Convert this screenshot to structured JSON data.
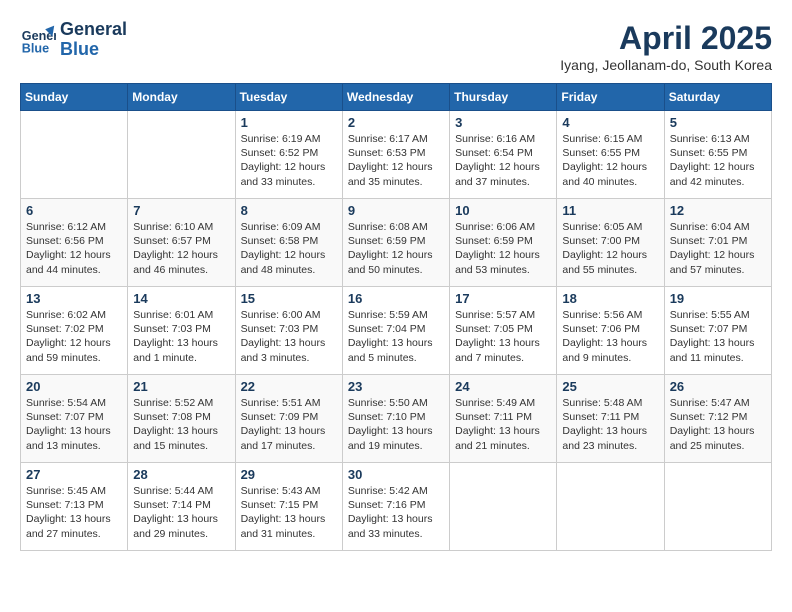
{
  "header": {
    "logo_line1": "General",
    "logo_line2": "Blue",
    "month": "April 2025",
    "location": "Iyang, Jeollanam-do, South Korea"
  },
  "days_of_week": [
    "Sunday",
    "Monday",
    "Tuesday",
    "Wednesday",
    "Thursday",
    "Friday",
    "Saturday"
  ],
  "weeks": [
    [
      {
        "day": "",
        "empty": true
      },
      {
        "day": "",
        "empty": true
      },
      {
        "day": "1",
        "sunrise": "6:19 AM",
        "sunset": "6:52 PM",
        "daylight": "12 hours and 33 minutes."
      },
      {
        "day": "2",
        "sunrise": "6:17 AM",
        "sunset": "6:53 PM",
        "daylight": "12 hours and 35 minutes."
      },
      {
        "day": "3",
        "sunrise": "6:16 AM",
        "sunset": "6:54 PM",
        "daylight": "12 hours and 37 minutes."
      },
      {
        "day": "4",
        "sunrise": "6:15 AM",
        "sunset": "6:55 PM",
        "daylight": "12 hours and 40 minutes."
      },
      {
        "day": "5",
        "sunrise": "6:13 AM",
        "sunset": "6:55 PM",
        "daylight": "12 hours and 42 minutes."
      }
    ],
    [
      {
        "day": "6",
        "sunrise": "6:12 AM",
        "sunset": "6:56 PM",
        "daylight": "12 hours and 44 minutes."
      },
      {
        "day": "7",
        "sunrise": "6:10 AM",
        "sunset": "6:57 PM",
        "daylight": "12 hours and 46 minutes."
      },
      {
        "day": "8",
        "sunrise": "6:09 AM",
        "sunset": "6:58 PM",
        "daylight": "12 hours and 48 minutes."
      },
      {
        "day": "9",
        "sunrise": "6:08 AM",
        "sunset": "6:59 PM",
        "daylight": "12 hours and 50 minutes."
      },
      {
        "day": "10",
        "sunrise": "6:06 AM",
        "sunset": "6:59 PM",
        "daylight": "12 hours and 53 minutes."
      },
      {
        "day": "11",
        "sunrise": "6:05 AM",
        "sunset": "7:00 PM",
        "daylight": "12 hours and 55 minutes."
      },
      {
        "day": "12",
        "sunrise": "6:04 AM",
        "sunset": "7:01 PM",
        "daylight": "12 hours and 57 minutes."
      }
    ],
    [
      {
        "day": "13",
        "sunrise": "6:02 AM",
        "sunset": "7:02 PM",
        "daylight": "12 hours and 59 minutes."
      },
      {
        "day": "14",
        "sunrise": "6:01 AM",
        "sunset": "7:03 PM",
        "daylight": "13 hours and 1 minute."
      },
      {
        "day": "15",
        "sunrise": "6:00 AM",
        "sunset": "7:03 PM",
        "daylight": "13 hours and 3 minutes."
      },
      {
        "day": "16",
        "sunrise": "5:59 AM",
        "sunset": "7:04 PM",
        "daylight": "13 hours and 5 minutes."
      },
      {
        "day": "17",
        "sunrise": "5:57 AM",
        "sunset": "7:05 PM",
        "daylight": "13 hours and 7 minutes."
      },
      {
        "day": "18",
        "sunrise": "5:56 AM",
        "sunset": "7:06 PM",
        "daylight": "13 hours and 9 minutes."
      },
      {
        "day": "19",
        "sunrise": "5:55 AM",
        "sunset": "7:07 PM",
        "daylight": "13 hours and 11 minutes."
      }
    ],
    [
      {
        "day": "20",
        "sunrise": "5:54 AM",
        "sunset": "7:07 PM",
        "daylight": "13 hours and 13 minutes."
      },
      {
        "day": "21",
        "sunrise": "5:52 AM",
        "sunset": "7:08 PM",
        "daylight": "13 hours and 15 minutes."
      },
      {
        "day": "22",
        "sunrise": "5:51 AM",
        "sunset": "7:09 PM",
        "daylight": "13 hours and 17 minutes."
      },
      {
        "day": "23",
        "sunrise": "5:50 AM",
        "sunset": "7:10 PM",
        "daylight": "13 hours and 19 minutes."
      },
      {
        "day": "24",
        "sunrise": "5:49 AM",
        "sunset": "7:11 PM",
        "daylight": "13 hours and 21 minutes."
      },
      {
        "day": "25",
        "sunrise": "5:48 AM",
        "sunset": "7:11 PM",
        "daylight": "13 hours and 23 minutes."
      },
      {
        "day": "26",
        "sunrise": "5:47 AM",
        "sunset": "7:12 PM",
        "daylight": "13 hours and 25 minutes."
      }
    ],
    [
      {
        "day": "27",
        "sunrise": "5:45 AM",
        "sunset": "7:13 PM",
        "daylight": "13 hours and 27 minutes."
      },
      {
        "day": "28",
        "sunrise": "5:44 AM",
        "sunset": "7:14 PM",
        "daylight": "13 hours and 29 minutes."
      },
      {
        "day": "29",
        "sunrise": "5:43 AM",
        "sunset": "7:15 PM",
        "daylight": "13 hours and 31 minutes."
      },
      {
        "day": "30",
        "sunrise": "5:42 AM",
        "sunset": "7:16 PM",
        "daylight": "13 hours and 33 minutes."
      },
      {
        "day": "",
        "empty": true
      },
      {
        "day": "",
        "empty": true
      },
      {
        "day": "",
        "empty": true
      }
    ]
  ]
}
